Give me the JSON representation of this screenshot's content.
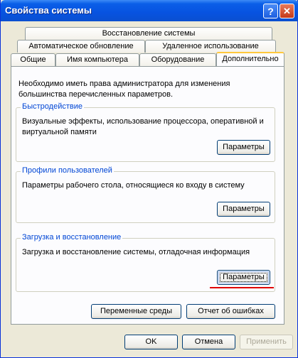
{
  "window": {
    "title": "Свойства системы",
    "help_label": "?",
    "close_label": "✕"
  },
  "tabs": {
    "row1": [
      "Восстановление системы"
    ],
    "row2": [
      "Автоматическое обновление",
      "Удаленное использование"
    ],
    "row3": [
      "Общие",
      "Имя компьютера",
      "Оборудование",
      "Дополнительно"
    ],
    "active": "Дополнительно"
  },
  "page": {
    "intro": "Необходимо иметь права администратора для изменения большинства перечисленных параметров.",
    "groups": [
      {
        "title": "Быстродействие",
        "text": "Визуальные эффекты, использование процессора, оперативной и виртуальной памяти",
        "button": "Параметры"
      },
      {
        "title": "Профили пользователей",
        "text": "Параметры рабочего стола, относящиеся ко входу в систему",
        "button": "Параметры"
      },
      {
        "title": "Загрузка и восстановление",
        "text": "Загрузка и восстановление системы, отладочная информация",
        "button": "Параметры"
      }
    ],
    "env_button": "Переменные среды",
    "errors_button": "Отчет об ошибках"
  },
  "footer": {
    "ok": "OK",
    "cancel": "Отмена",
    "apply": "Применить"
  }
}
